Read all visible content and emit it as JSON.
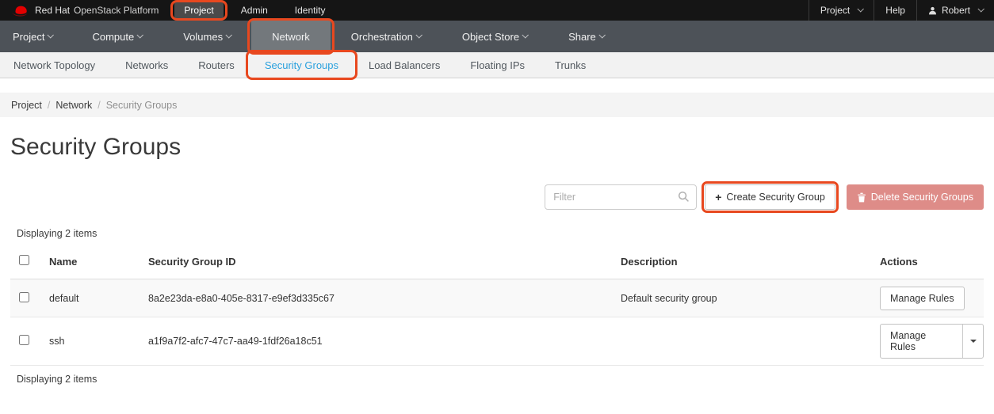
{
  "topbar": {
    "brand_bold": "Red Hat",
    "brand_rest": "OpenStack Platform",
    "tabs": [
      {
        "label": "Project"
      },
      {
        "label": "Admin"
      },
      {
        "label": "Identity"
      }
    ],
    "region_dropdown": "Project",
    "help": "Help",
    "user": "Robert"
  },
  "navbar": {
    "items": [
      {
        "label": "Project"
      },
      {
        "label": "Compute"
      },
      {
        "label": "Volumes"
      },
      {
        "label": "Network"
      },
      {
        "label": "Orchestration"
      },
      {
        "label": "Object Store"
      },
      {
        "label": "Share"
      }
    ]
  },
  "subnav": {
    "items": [
      {
        "label": "Network Topology"
      },
      {
        "label": "Networks"
      },
      {
        "label": "Routers"
      },
      {
        "label": "Security Groups"
      },
      {
        "label": "Load Balancers"
      },
      {
        "label": "Floating IPs"
      },
      {
        "label": "Trunks"
      }
    ]
  },
  "breadcrumb": {
    "separator": "/",
    "items": [
      {
        "label": "Project"
      },
      {
        "label": "Network"
      },
      {
        "label": "Security Groups"
      }
    ]
  },
  "page": {
    "title": "Security Groups"
  },
  "toolbar": {
    "filter_placeholder": "Filter",
    "create_plus": "+",
    "create_label": "Create Security Group",
    "delete_label": "Delete Security Groups"
  },
  "table": {
    "summary_top": "Displaying 2 items",
    "summary_bottom": "Displaying 2 items",
    "columns": {
      "name": "Name",
      "id": "Security Group ID",
      "description": "Description",
      "actions": "Actions"
    },
    "rows": [
      {
        "name": "default",
        "id": "8a2e23da-e8a0-405e-8317-e9ef3d335c67",
        "description": "Default security group",
        "action": "Manage Rules"
      },
      {
        "name": "ssh",
        "id": "a1f9a7f2-afc7-47c7-aa49-1fdf26a18c51",
        "description": "",
        "action": "Manage Rules"
      }
    ]
  },
  "colors": {
    "annotation": "#e8481f",
    "active_link": "#2ba1dd",
    "topbar_bg": "#151515",
    "navbar_bg": "#4d5258",
    "navbar_active_bg": "#73787c",
    "danger_disabled_bg": "#de8c88"
  }
}
